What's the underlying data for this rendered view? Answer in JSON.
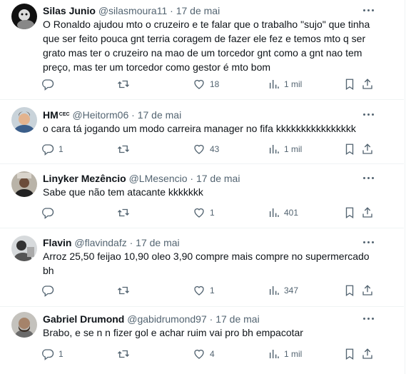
{
  "more_icon": "more-horizontal-icon",
  "icons": {
    "reply": "reply-icon",
    "retweet": "retweet-icon",
    "like": "heart-icon",
    "views": "views-chart-icon",
    "bookmark": "bookmark-icon",
    "share": "share-icon"
  },
  "tweets": [
    {
      "name": "Silas Junio",
      "handle": "@silasmoura11",
      "dot": "·",
      "date": "17 de mai",
      "text": "O Ronaldo ajudou mto o cruzeiro e te falar  que o trabalho \"sujo\" que tinha que ser feito pouca gnt terria coragem de fazer ele fez e temos mto q ser grato mas ter o cruzeiro na mao de um torcedor gnt como a gnt nao tem preço, mas ter um torcedor como gestor é mto bom",
      "replies": "",
      "retweets": "",
      "likes": "18",
      "views": "1 mil"
    },
    {
      "name": "HM",
      "name_sup": "CEC",
      "handle": "@Heitorm06",
      "dot": "·",
      "date": "17 de mai",
      "text": "o cara tá jogando um modo carreira manager no fifa kkkkkkkkkkkkkkkk",
      "replies": "1",
      "retweets": "",
      "likes": "43",
      "views": "1 mil"
    },
    {
      "name": "Linyker Mezêncio",
      "handle": "@LMesencio",
      "dot": "·",
      "date": "17 de mai",
      "text": "Sabe que não tem atacante kkkkkkk",
      "replies": "",
      "retweets": "",
      "likes": "1",
      "views": "401"
    },
    {
      "name": "Flavin",
      "handle": "@flavindafz",
      "dot": "·",
      "date": "17 de mai",
      "text": "Arroz 25,50 feijao 10,90 oleo 3,90 compre mais compre no supermercado bh",
      "replies": "",
      "retweets": "",
      "likes": "1",
      "views": "347"
    },
    {
      "name": "Gabriel Drumond",
      "handle": "@gabidrumond97",
      "dot": "·",
      "date": "17 de mai",
      "text": "Brabo, e se n n fizer gol e achar ruim vai pro bh empacotar",
      "replies": "1",
      "retweets": "",
      "likes": "4",
      "views": "1 mil"
    }
  ]
}
